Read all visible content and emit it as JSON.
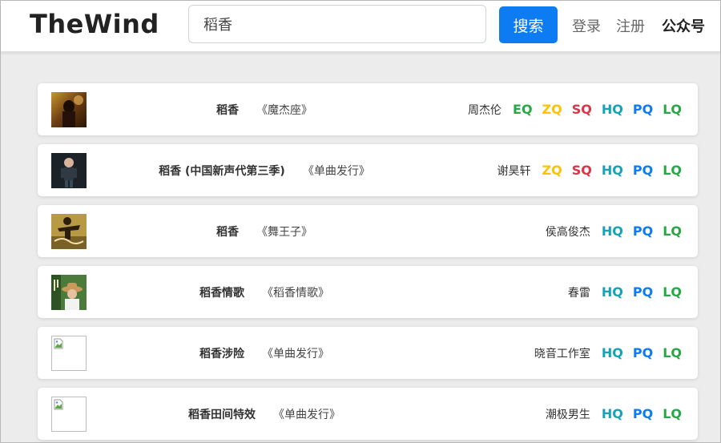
{
  "header": {
    "logo": "TheWind",
    "search_value": "稻香",
    "search_button": "搜索",
    "login": "登录",
    "register": "注册",
    "public_account": "公众号"
  },
  "colors": {
    "primary": "#0d7cf2",
    "EQ": "#28a745",
    "ZQ": "#ffc107",
    "SQ": "#dc3545",
    "HQ": "#17a2b8",
    "PQ": "#0d7cf2",
    "LQ": "#28a745"
  },
  "songs": [
    {
      "title": "稻香",
      "album": "《魔杰座》",
      "artist": "周杰伦",
      "qualities": [
        "EQ",
        "ZQ",
        "SQ",
        "HQ",
        "PQ",
        "LQ"
      ],
      "cover": "photo-warm"
    },
    {
      "title": "稻香 (中国新声代第三季)",
      "album": "《单曲发行》",
      "artist": "谢昊轩",
      "qualities": [
        "ZQ",
        "SQ",
        "HQ",
        "PQ",
        "LQ"
      ],
      "cover": "photo-dark"
    },
    {
      "title": "稻香",
      "album": "《舞王子》",
      "artist": "侯高俊杰",
      "qualities": [
        "HQ",
        "PQ",
        "LQ"
      ],
      "cover": "photo-gold"
    },
    {
      "title": "稻香情歌",
      "album": "《稻香情歌》",
      "artist": "春雷",
      "qualities": [
        "HQ",
        "PQ",
        "LQ"
      ],
      "cover": "photo-green"
    },
    {
      "title": "稻香涉险",
      "album": "《单曲发行》",
      "artist": "晓音工作室",
      "qualities": [
        "HQ",
        "PQ",
        "LQ"
      ],
      "cover": "broken"
    },
    {
      "title": "稻香田间特效",
      "album": "《单曲发行》",
      "artist": "潮极男生",
      "qualities": [
        "HQ",
        "PQ",
        "LQ"
      ],
      "cover": "broken"
    }
  ]
}
